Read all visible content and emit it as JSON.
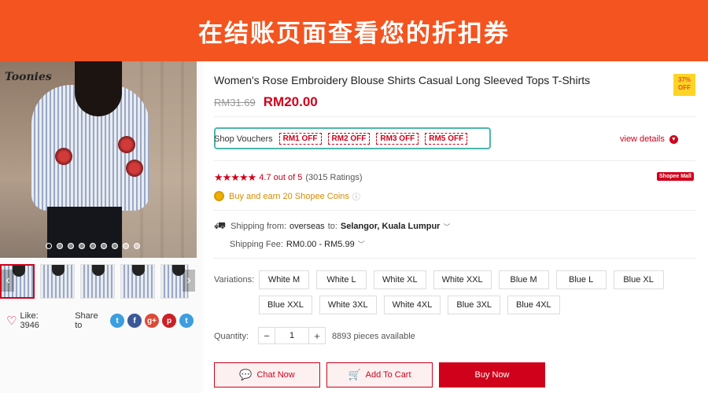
{
  "banner": {
    "text": "在结账页面查看您的折扣券"
  },
  "gallery": {
    "brand": "Toonies",
    "like_label": "Like: 3946",
    "share_label": "Share to",
    "share_buttons": [
      {
        "icon": "twitter-icon",
        "glyph": "t",
        "color": "#3b9ee0"
      },
      {
        "icon": "facebook-icon",
        "glyph": "f",
        "color": "#3b5998"
      },
      {
        "icon": "google-plus-icon",
        "glyph": "g+",
        "color": "#dc4a38"
      },
      {
        "icon": "pinterest-icon",
        "glyph": "p",
        "color": "#cb2027"
      },
      {
        "icon": "twitter-icon",
        "glyph": "t",
        "color": "#3b9ee0"
      }
    ]
  },
  "product": {
    "title": "Women's Rose Embroidery Blouse Shirts Casual Long Sleeved Tops T-Shirts",
    "discount_badge": {
      "pct": "37%",
      "off": "OFF"
    },
    "old_price": "RM31.69",
    "new_price": "RM20.00"
  },
  "vouchers": {
    "label": "Shop Vouchers",
    "items": [
      "RM1 OFF",
      "RM2 OFF",
      "RM3 OFF",
      "RM5 OFF"
    ],
    "view_details": "view details"
  },
  "rating": {
    "stars": "★★★★★",
    "score": "4.7 out of 5",
    "count": "(3015 Ratings)",
    "mall_badge": "Shopee Mall"
  },
  "coins": {
    "text": "Buy and earn 20 Shopee Coins",
    "info": "ⓘ"
  },
  "shipping": {
    "from_label": "Shipping  from:",
    "from_value": "overseas",
    "to_label": "to:",
    "to_value": "Selangor, Kuala Lumpur",
    "fee_label": "Shipping Fee:",
    "fee_value": "RM0.00 - RM5.99"
  },
  "variations": {
    "label": "Variations:",
    "options": [
      "White M",
      "White L",
      "White XL",
      "White XXL",
      "Blue M",
      "Blue L",
      "Blue XL",
      "Blue XXL",
      "White 3XL",
      "White 4XL",
      "Blue 3XL",
      "Blue 4XL"
    ]
  },
  "quantity": {
    "label": "Quantity:",
    "minus": "−",
    "value": "1",
    "plus": "+",
    "available": "8893 pieces available"
  },
  "actions": {
    "chat": "Chat Now",
    "cart": "Add To Cart",
    "buy": "Buy Now"
  },
  "colors": {
    "banner": "#f4541f",
    "accent": "#d0011b",
    "voucher_frame": "#4db6ac"
  }
}
